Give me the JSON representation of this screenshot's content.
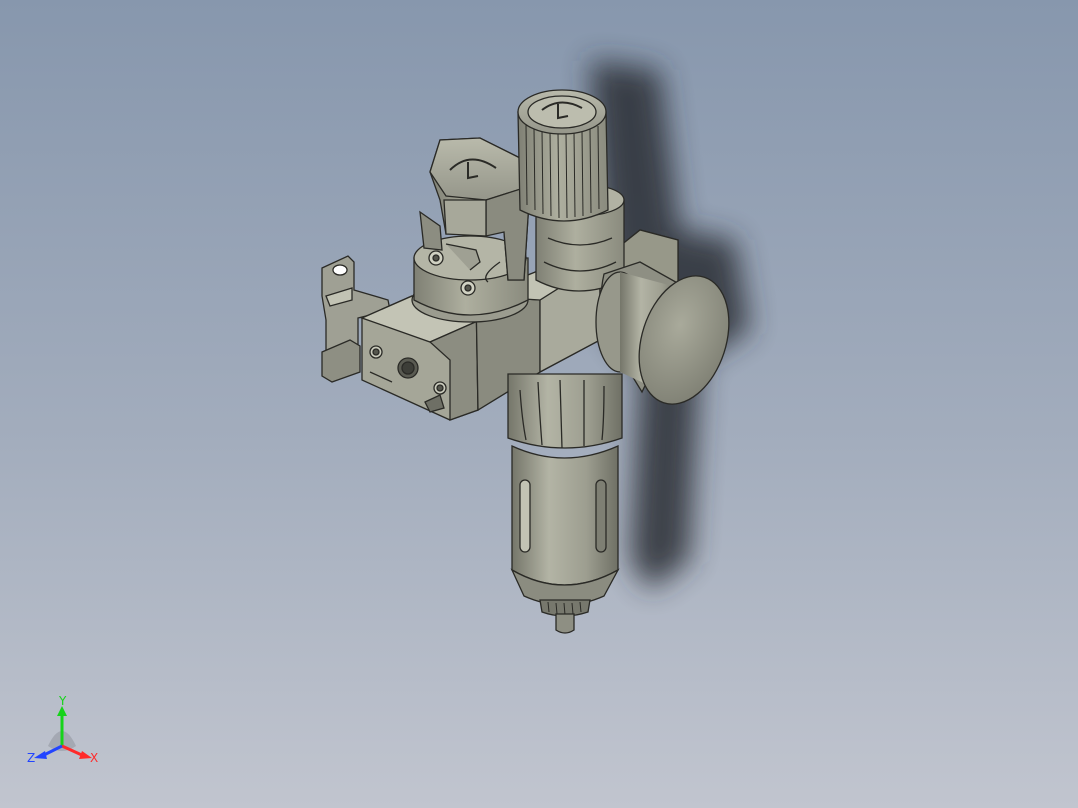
{
  "viewport": {
    "background_top": "#8797ad",
    "background_bottom": "#c1c5cf",
    "model_color": "#9a9b8e",
    "shadow_color": "#2b2f36"
  },
  "triad": {
    "x_label": "X",
    "y_label": "Y",
    "z_label": "Z",
    "x_color": "#ff2a2a",
    "y_color": "#16d31a",
    "z_color": "#2244ff"
  }
}
